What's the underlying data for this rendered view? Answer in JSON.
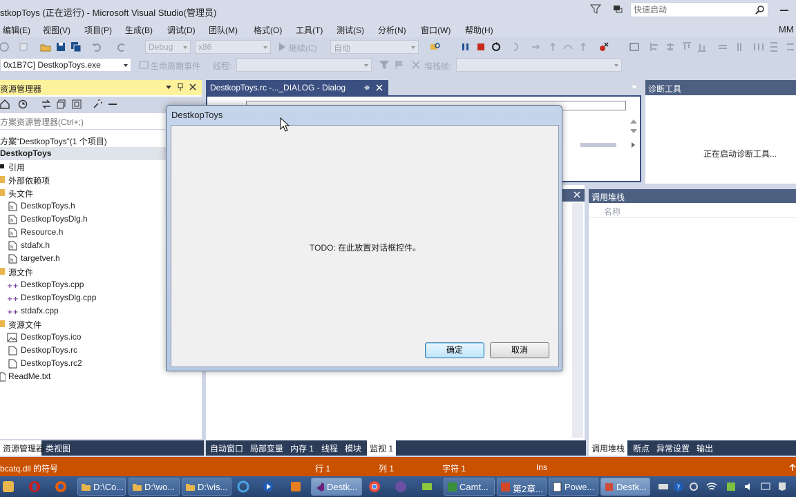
{
  "window": {
    "title": "stkopToys (正在运行) - Microsoft Visual Studio(管理员)",
    "quick_launch_placeholder": "快速启动",
    "user_initials": "MM"
  },
  "menu": [
    "编辑(E)",
    "视图(V)",
    "项目(P)",
    "生成(B)",
    "调试(D)",
    "团队(M)",
    "格式(O)",
    "工具(T)",
    "测试(S)",
    "分析(N)",
    "窗口(W)",
    "帮助(H)"
  ],
  "toolbar": {
    "config": "Debug",
    "platform": "x86",
    "continue_label": "继续(C)",
    "auto_label": "自动",
    "process": "0x1B7C] DestkopToys.exe",
    "lifecycle_label": "生命周期事件",
    "thread_label": "线程:",
    "stack_frame_label": "堆栈帧:"
  },
  "solution_explorer": {
    "title": "资源管理器",
    "search_placeholder": "方案资源管理器(Ctrl+;)",
    "solution_label": "方案“DestkopToys”(1 个项目)",
    "project": "DestkopToys",
    "items": [
      {
        "label": "引用",
        "kind": "ref"
      },
      {
        "label": "外部依赖项",
        "kind": "folder"
      },
      {
        "label": "头文件",
        "kind": "folder"
      },
      {
        "label": "DestkopToys.h",
        "kind": "h"
      },
      {
        "label": "DestkopToysDlg.h",
        "kind": "h"
      },
      {
        "label": "Resource.h",
        "kind": "h"
      },
      {
        "label": "stdafx.h",
        "kind": "h"
      },
      {
        "label": "targetver.h",
        "kind": "h"
      },
      {
        "label": "源文件",
        "kind": "folder"
      },
      {
        "label": "DestkopToys.cpp",
        "kind": "cpp"
      },
      {
        "label": "DestkopToysDlg.cpp",
        "kind": "cpp"
      },
      {
        "label": "stdafx.cpp",
        "kind": "cpp"
      },
      {
        "label": "资源文件",
        "kind": "folder"
      },
      {
        "label": "DestkopToys.ico",
        "kind": "ico"
      },
      {
        "label": "DestkopToys.rc",
        "kind": "rc"
      },
      {
        "label": "DestkopToys.rc2",
        "kind": "rc"
      },
      {
        "label": "ReadMe.txt",
        "kind": "txt"
      }
    ],
    "tabs": [
      "资源管理器",
      "类视图"
    ]
  },
  "editor": {
    "tab_title": "DestkopToys.rc -..._DIALOG - Dialog"
  },
  "diagnostics": {
    "title": "诊断工具",
    "status": "正在启动诊断工具..."
  },
  "watch": {
    "tabs": [
      "自动窗口",
      "局部变量",
      "内存 1",
      "线程",
      "模块",
      "监视 1"
    ]
  },
  "callstack": {
    "title": "调用堆栈",
    "column_name": "名称",
    "tabs": [
      "调用堆栈",
      "断点",
      "异常设置",
      "输出"
    ]
  },
  "statusbar": {
    "message": "bcatq.dll 的符号",
    "line": "行 1",
    "col": "列 1",
    "char": "字符 1",
    "mode": "Ins"
  },
  "taskbar": {
    "buttons": [
      "D:\\Co...",
      "D:\\wo...",
      "D:\\vis...",
      "Destk...",
      "Camt...",
      "第2章...",
      "Powe...",
      "Destk..."
    ]
  },
  "dialog": {
    "title": "DestkopToys",
    "text": "TODO: 在此放置对话框控件。",
    "ok_label": "确定",
    "cancel_label": "取消"
  }
}
